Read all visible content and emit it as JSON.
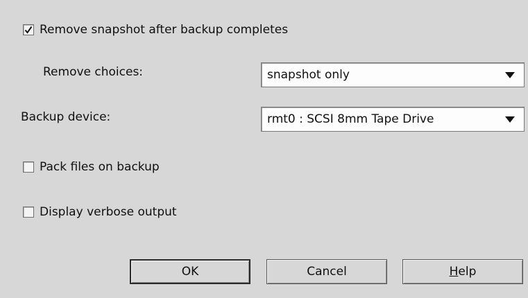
{
  "options": {
    "remove_snapshot": {
      "label": "Remove snapshot after backup completes",
      "checked": true
    },
    "pack_files": {
      "label": "Pack files on backup",
      "checked": false
    },
    "verbose": {
      "label": "Display verbose output",
      "checked": false
    }
  },
  "remove_choices": {
    "label": "Remove choices:",
    "value": "snapshot only"
  },
  "backup_device": {
    "label": "Backup device:",
    "value": "rmt0 : SCSI 8mm Tape Drive"
  },
  "buttons": {
    "ok": "OK",
    "cancel": "Cancel",
    "help_mnemonic": "H",
    "help_rest": "elp"
  },
  "icons": {
    "check": "checkmark-icon",
    "dropdown": "triangle-down-icon"
  }
}
